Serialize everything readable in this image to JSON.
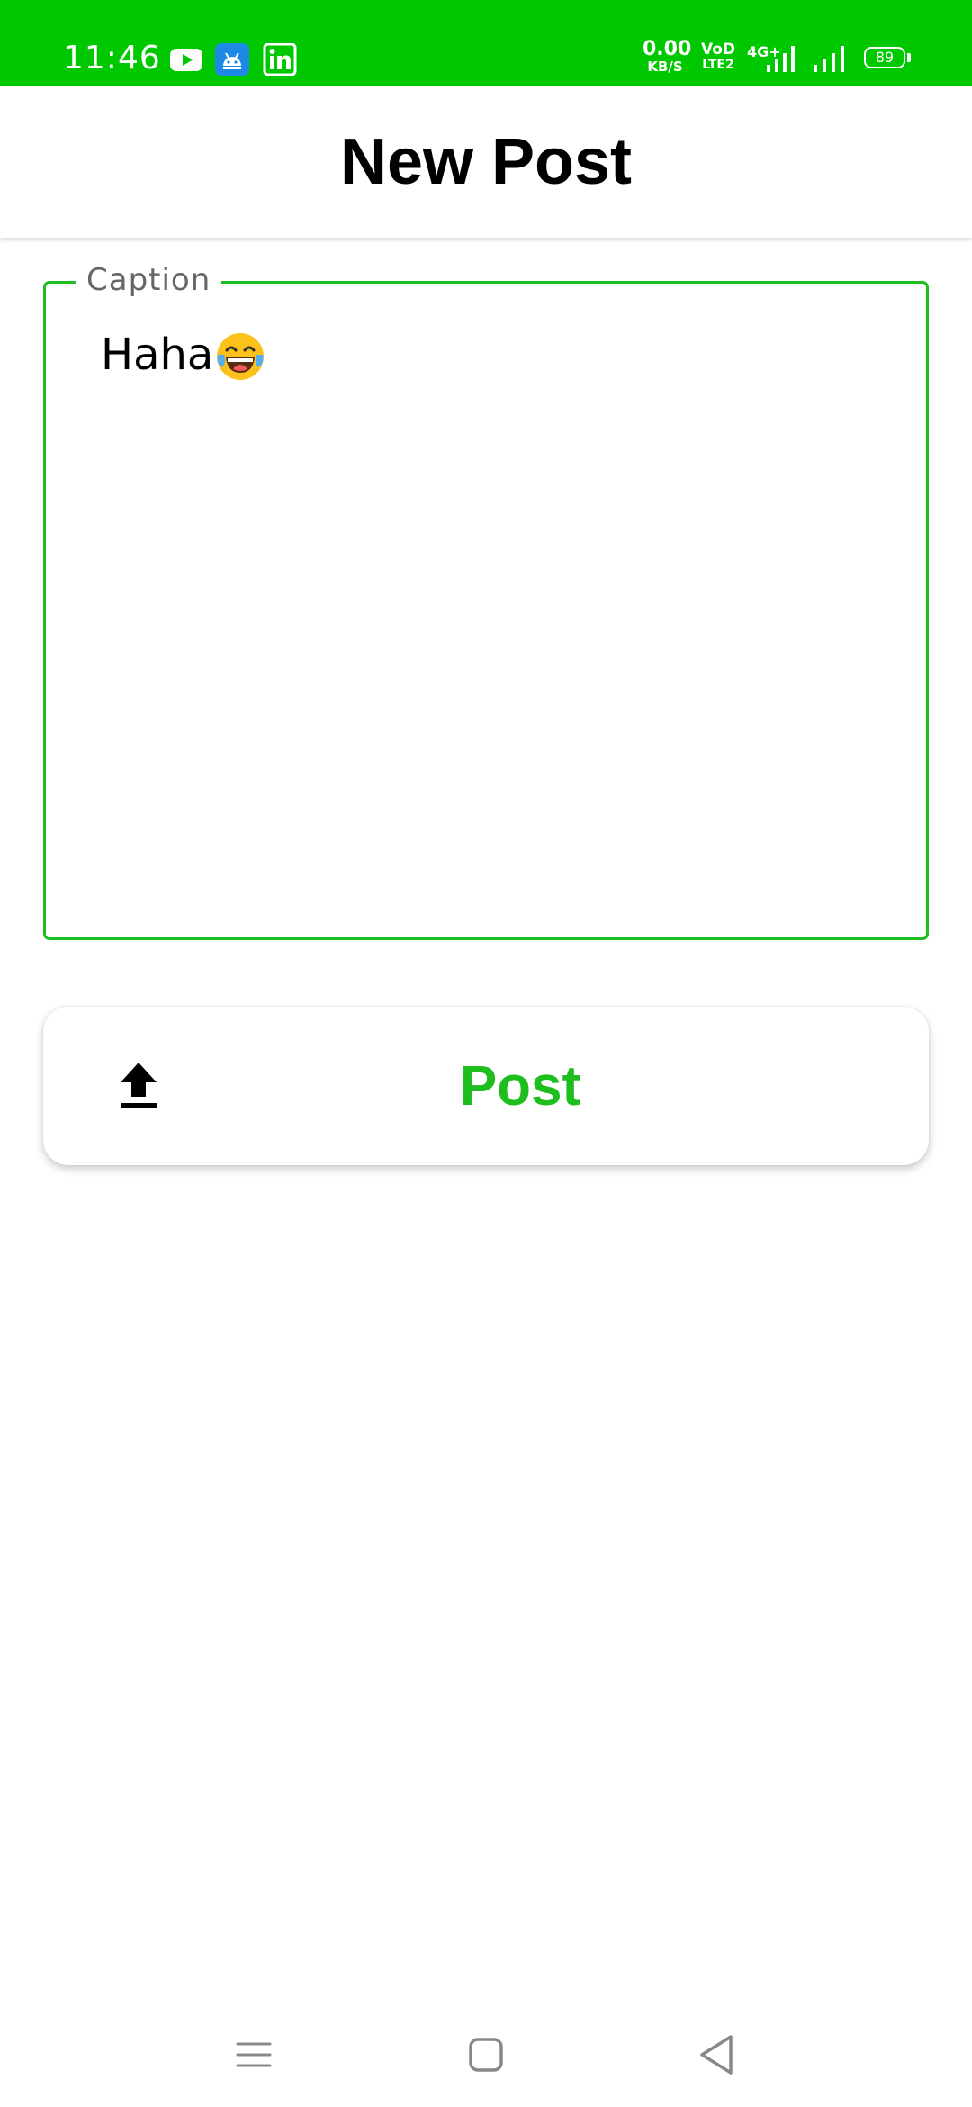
{
  "status_bar": {
    "time": "11:46",
    "notification_icons": [
      "youtube-icon",
      "android-icon",
      "linkedin-icon"
    ],
    "network_speed": {
      "value": "0.00",
      "unit": "KB/S"
    },
    "volte": {
      "top": "VoD",
      "bottom": "LTE2"
    },
    "network_type": "4G+",
    "battery_level": "89",
    "background_color": "#00c800"
  },
  "app_bar": {
    "title": "New Post"
  },
  "caption_field": {
    "label": "Caption",
    "value": "Haha",
    "emoji": "face-with-tears-of-joy",
    "accent_color": "#1fbe1f"
  },
  "post_button": {
    "label": "Post",
    "icon": "upload-icon",
    "label_color": "#1fbe1f"
  },
  "nav_bar": {
    "buttons": [
      "menu-icon",
      "home-icon",
      "back-icon"
    ]
  }
}
